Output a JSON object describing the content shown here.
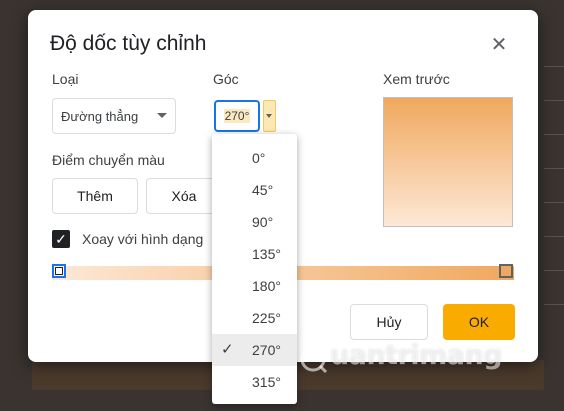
{
  "dialog": {
    "title": "Độ dốc tùy chỉnh",
    "close_icon": "close-icon"
  },
  "type": {
    "label": "Loại",
    "selected": "Đường thẳng"
  },
  "angle": {
    "label": "Góc",
    "value": "270°",
    "options": [
      "0°",
      "45°",
      "90°",
      "135°",
      "180°",
      "225°",
      "270°",
      "315°"
    ],
    "selected_index": 6
  },
  "preview": {
    "label": "Xem trước"
  },
  "stops": {
    "label": "Điểm chuyển màu",
    "add_label": "Thêm",
    "delete_label": "Xóa"
  },
  "rotate": {
    "label": "Xoay với hình dạng",
    "checked": true
  },
  "gradient": {
    "start_color": "#fde8d6",
    "end_color": "#f0a85e"
  },
  "actions": {
    "cancel_label": "Hủy",
    "ok_label": "OK"
  },
  "colors": {
    "accent": "#1a73e8",
    "ok_button": "#f9ab00"
  },
  "watermark": {
    "text": "uantrimang"
  }
}
